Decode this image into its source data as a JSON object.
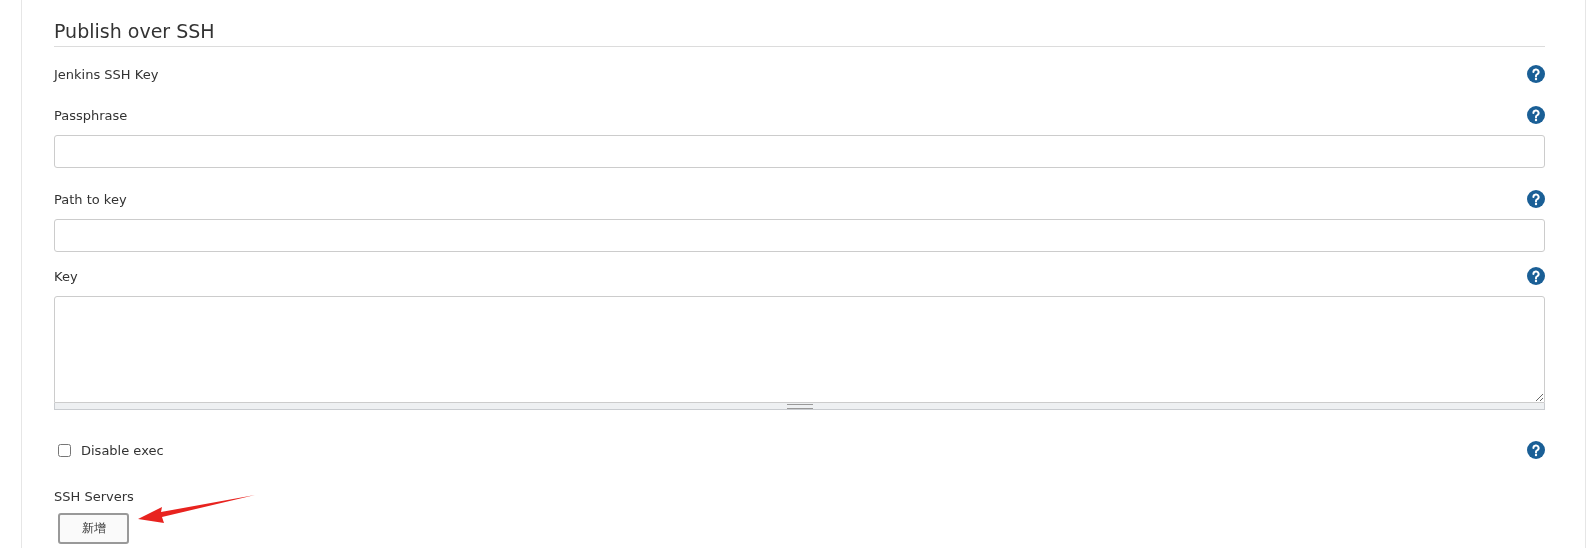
{
  "section": {
    "title": "Publish over SSH"
  },
  "fields": [
    {
      "kind": "heading",
      "label": "Jenkins SSH Key",
      "help": true
    },
    {
      "kind": "input",
      "label": "Passphrase",
      "help": true
    },
    {
      "kind": "input",
      "label": "Path to key",
      "help": true
    },
    {
      "kind": "textarea",
      "label": "Key",
      "help": true
    },
    {
      "kind": "checkbox",
      "label": "Disable exec",
      "checked": false,
      "help": true
    }
  ],
  "servers": {
    "label": "SSH Servers",
    "button": "新增",
    "annotation_arrow": true
  }
}
